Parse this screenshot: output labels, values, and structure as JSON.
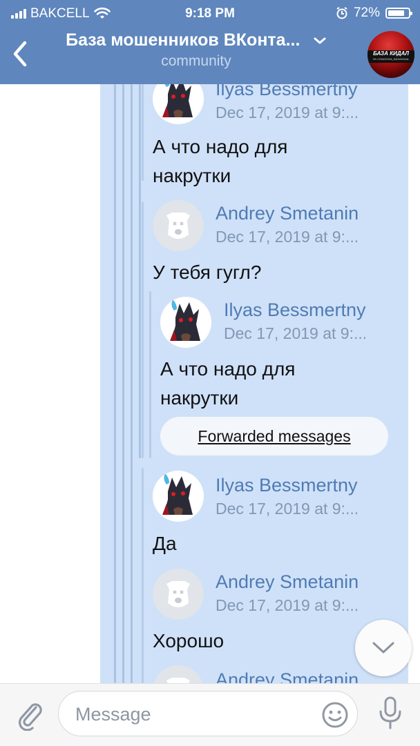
{
  "status_bar": {
    "carrier": "BAKCELL",
    "time": "9:18 PM",
    "battery": "72%",
    "battery_level": 0.72
  },
  "header": {
    "title": "База мошенников ВКонта...",
    "subtitle": "community",
    "back_icon": "chevron-left-icon",
    "dropdown_icon": "chevron-down-icon",
    "group_avatar": {
      "text": "БАЗА КИДАЛ",
      "subtext": "VK.COM/ZONA_BASAKIDAL",
      "color": "#c41818"
    }
  },
  "messages": [
    {
      "author": "Ilyas Bessmertny",
      "date": "Dec 17, 2019 at 9:...",
      "text_lines": []
    },
    {
      "author": "",
      "date": "",
      "text_lines": [
        "А что надо для",
        "накрутки"
      ]
    },
    {
      "author": "Andrey Smetanin",
      "date": "Dec 17, 2019 at 9:...",
      "text_lines": [
        "У тебя гугл?"
      ]
    },
    {
      "author": "Ilyas Bessmertny",
      "date": "Dec 17, 2019 at 9:...",
      "text_lines": [
        "А что надо для",
        "накрутки"
      ],
      "nested": true
    },
    {
      "author": "Ilyas Bessmertny",
      "date": "Dec 17, 2019 at 9:...",
      "text_lines": [
        "Да"
      ]
    },
    {
      "author": "Andrey Smetanin",
      "date": "Dec 17, 2019 at 9:...",
      "text_lines": [
        "Хорошо"
      ]
    },
    {
      "author": "Andrey Smetanin",
      "date": "",
      "text_lines": []
    }
  ],
  "forwarded_button": "Forwarded messages",
  "input": {
    "placeholder": "Message",
    "value": ""
  },
  "icons": {
    "attach": "paperclip-icon",
    "emoji": "smile-icon",
    "voice": "microphone-icon",
    "scroll": "chevron-down-icon"
  },
  "colors": {
    "header_bg": "#5f86bd",
    "bubble_bg": "#cfe1f8",
    "name": "#4f7bb4",
    "date": "#8197b3"
  }
}
